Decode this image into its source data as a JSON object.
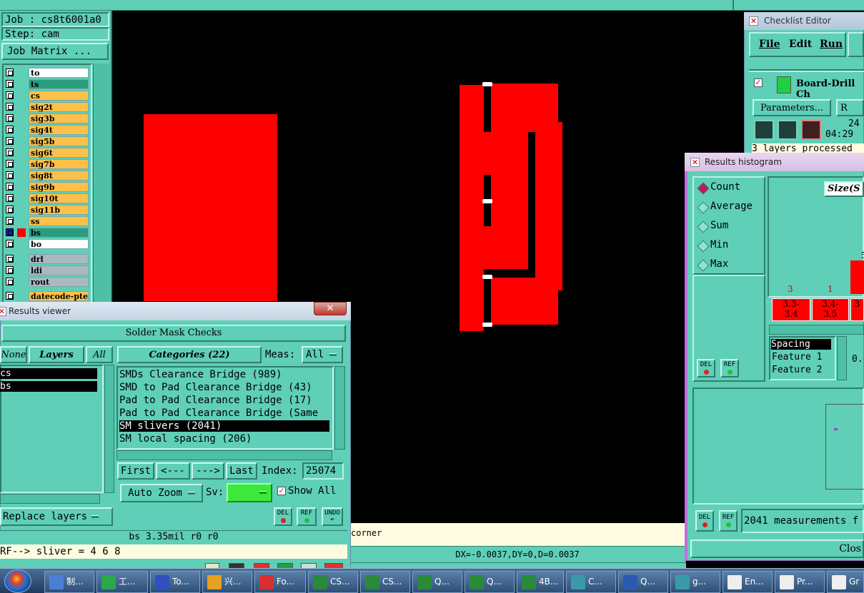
{
  "job": {
    "job_label": "Job : cs8t6001a0",
    "step_label": "Step: cam",
    "job_matrix_button": "Job Matrix ..."
  },
  "layers": [
    {
      "name": "to",
      "color": "#ffffff"
    },
    {
      "name": "ts",
      "color": "#2a9d80"
    },
    {
      "name": "cs",
      "color": "#ffc04a"
    },
    {
      "name": "sig2t",
      "color": "#ffc04a"
    },
    {
      "name": "sig3b",
      "color": "#ffc04a"
    },
    {
      "name": "sig4t",
      "color": "#ffc04a"
    },
    {
      "name": "sig5b",
      "color": "#ffc04a"
    },
    {
      "name": "sig6t",
      "color": "#ffc04a"
    },
    {
      "name": "sig7b",
      "color": "#ffc04a"
    },
    {
      "name": "sig8t",
      "color": "#ffc04a"
    },
    {
      "name": "sig9b",
      "color": "#ffc04a"
    },
    {
      "name": "sig10t",
      "color": "#ffc04a"
    },
    {
      "name": "sig11b",
      "color": "#ffc04a"
    },
    {
      "name": "ss",
      "color": "#ffc04a"
    },
    {
      "name": "bs",
      "color": "#2a9d80"
    },
    {
      "name": "bo",
      "color": "#ffffff"
    },
    {
      "name": "drl",
      "color": "#aab8c0"
    },
    {
      "name": "ldi",
      "color": "#aab8c0"
    },
    {
      "name": "rout",
      "color": "#aab8c0"
    },
    {
      "name": "datecode-pte",
      "color": "#ffc04a"
    }
  ],
  "results_viewer": {
    "title": "Results viewer",
    "header": "Solder Mask Checks",
    "none_btn": "None",
    "layers_btn": "Layers",
    "all_btn": "All",
    "layer_items": [
      "cs",
      "bs"
    ],
    "categories_btn": "Categories (22)",
    "meas_label": "Meas:",
    "meas_value": "All",
    "categories": [
      "SMDs Clearance Bridge (989)",
      "SMD to Pad Clearance Bridge (43)",
      "Pad to Pad Clearance Bridge (17)",
      "Pad to Pad Clearance Bridge (Same",
      "SM slivers (2041)",
      "SM local spacing (206)"
    ],
    "selected_category": 4,
    "first_btn": "First",
    "prev_btn": "<---",
    "next_btn": "--->",
    "last_btn": "Last",
    "index_label": "Index:",
    "index_value": "25074",
    "auto_zoom": "Auto Zoom",
    "sv_label": "Sv:",
    "show_all": "Show All",
    "replace_layers": "Replace layers",
    "del": "DEL",
    "ref": "REF",
    "undo": "UNDO",
    "status1": "bs 3.35mil   r0   r0",
    "status2": "RF--> sliver = 4 6 8"
  },
  "canvas": {
    "corner_text": "corner",
    "coords": "DX=-0.0037,DY=0,D=0.0037"
  },
  "checklist_editor": {
    "title": "Checklist Editor",
    "menu": [
      "File",
      "Edit",
      "Run"
    ],
    "item": "Board-Drill Ch",
    "parameters_btn": "Parameters...",
    "r_btn": "R",
    "time_top": "24",
    "time": "04:29",
    "status": "3 layers processed"
  },
  "histogram": {
    "title": "Results histogram",
    "options": [
      "Count",
      "Average",
      "Sum",
      "Min",
      "Max"
    ],
    "selected": 0,
    "size_label": "Size(S",
    "bar_counts": [
      "3",
      "1",
      "5"
    ],
    "bins": [
      [
        "3.3-",
        "3.4"
      ],
      [
        "3.4-",
        "3.5"
      ],
      [
        "3",
        ""
      ]
    ],
    "list": [
      "Spacing",
      "Feature 1",
      "Feature 2"
    ],
    "side_value": "0.",
    "measurements": "2041 measurements f",
    "close_btn": "Clos",
    "del": "DEL",
    "ref": "REF"
  },
  "taskbar": {
    "items": [
      {
        "label": "制...",
        "color": "#4a7fd6"
      },
      {
        "label": "工...",
        "color": "#2aa84a"
      },
      {
        "label": "To...",
        "color": "#3050c0"
      },
      {
        "label": "兴...",
        "color": "#e8a020"
      },
      {
        "label": "Fo...",
        "color": "#d83030"
      },
      {
        "label": "CS...",
        "color": "#2a8a3a"
      },
      {
        "label": "CS...",
        "color": "#2a8a3a"
      },
      {
        "label": "Q...",
        "color": "#2a8a3a"
      },
      {
        "label": "Q...",
        "color": "#2a8a3a"
      },
      {
        "label": "4B...",
        "color": "#2a8a3a"
      },
      {
        "label": "C...",
        "color": "#3a9aa8"
      },
      {
        "label": "Q...",
        "color": "#2a5ab0"
      },
      {
        "label": "g...",
        "color": "#3a9aa8"
      },
      {
        "label": "En...",
        "color": "#eeeeee"
      },
      {
        "label": "Pr...",
        "color": "#eeeeee"
      },
      {
        "label": "Gr",
        "color": "#eeeeee"
      }
    ]
  }
}
